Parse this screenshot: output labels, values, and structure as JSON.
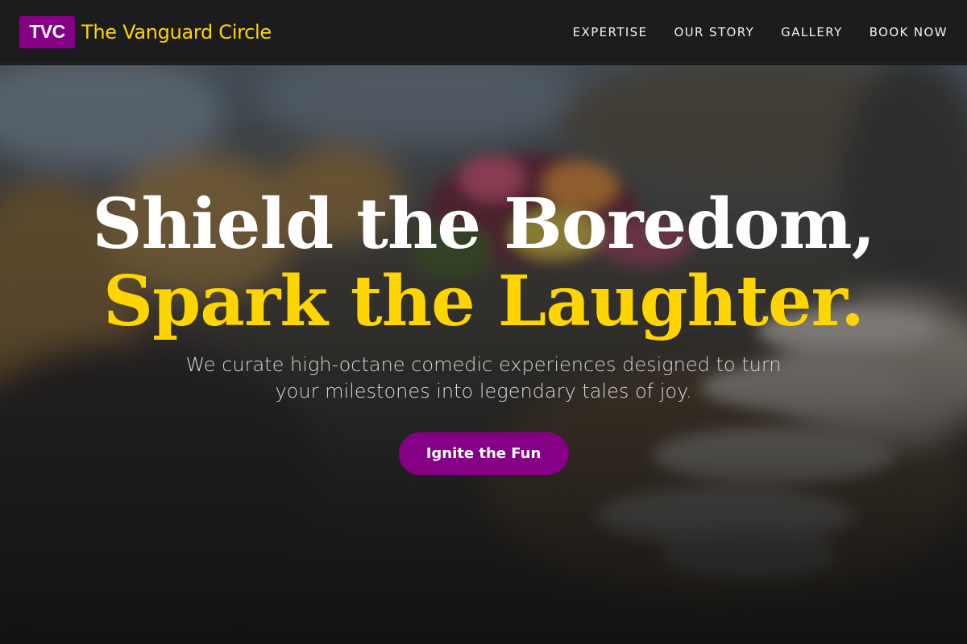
{
  "brand": {
    "mark": "TVC",
    "name": "The Vanguard Circle"
  },
  "nav": {
    "items": [
      {
        "label": "EXPERTISE"
      },
      {
        "label": "OUR STORY"
      },
      {
        "label": "GALLERY"
      },
      {
        "label": "BOOK NOW"
      }
    ]
  },
  "hero": {
    "headline_line1": "Shield the Boredom,",
    "headline_line2": "Spark the Laughter.",
    "subtitle": "We curate high-octane comedic experiences designed to turn your milestones into legendary tales of joy.",
    "cta_label": "Ignite the Fun",
    "background_image": "blurred-banquet-table-photo"
  },
  "colors": {
    "accent_purple": "#850085",
    "accent_yellow": "#ffd500",
    "header_bg": "#1c1c1e",
    "headline_white": "#ffffff"
  }
}
